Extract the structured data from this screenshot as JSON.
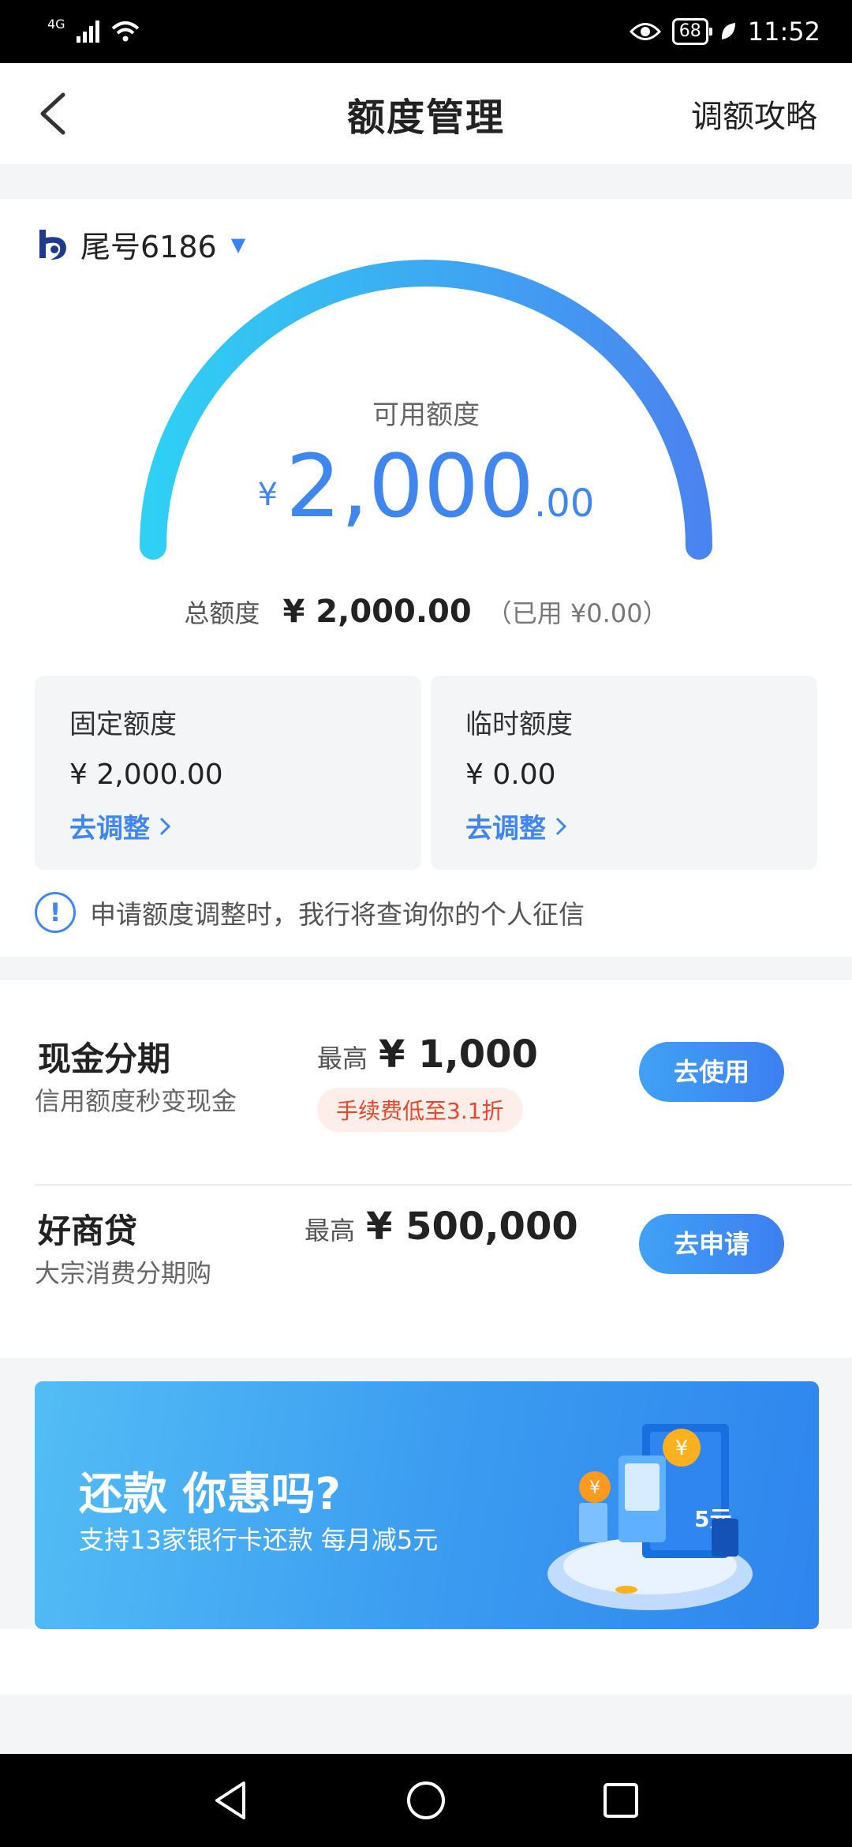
{
  "status_bar": {
    "network": "4G",
    "battery": "68",
    "time": "11:52"
  },
  "header": {
    "title": "额度管理",
    "right_link": "调额攻略"
  },
  "account": {
    "label": "尾号6186",
    "caret": "▼"
  },
  "gauge": {
    "label": "可用额度",
    "currency": "¥",
    "amount_int": "2,000",
    "amount_dec": ".00",
    "fill_fraction": 1.0
  },
  "total": {
    "label": "总额度",
    "value": "¥ 2,000.00",
    "used": "（已用 ¥0.00）"
  },
  "quotas": [
    {
      "title": "固定额度",
      "value": "¥ 2,000.00",
      "action": "去调整"
    },
    {
      "title": "临时额度",
      "value": "¥ 0.00",
      "action": "去调整"
    }
  ],
  "notice": {
    "icon": "!",
    "text": "申请额度调整时，我行将查询你的个人征信"
  },
  "products": [
    {
      "name": "现金分期",
      "desc": "信用额度秒变现金",
      "max_label": "最高",
      "max_value": "¥ 1,000",
      "tag": "手续费低至3.1折",
      "button": "去使用"
    },
    {
      "name": "好商贷",
      "desc": "大宗消费分期购",
      "max_label": "最高",
      "max_value": "¥ 500,000",
      "tag": "",
      "button": "去申请"
    }
  ],
  "banner": {
    "title": "还款 你惠吗?",
    "subtitle": "支持13家银行卡还款 每月减5元",
    "coin1": "¥",
    "coin2": "¥",
    "note": "5元"
  },
  "colors": {
    "accent": "#3f86ee",
    "gauge_start": "#2fd0f4",
    "gauge_end": "#4a84f0",
    "tag_bg": "#fdeeea",
    "tag_text": "#e8472c"
  }
}
